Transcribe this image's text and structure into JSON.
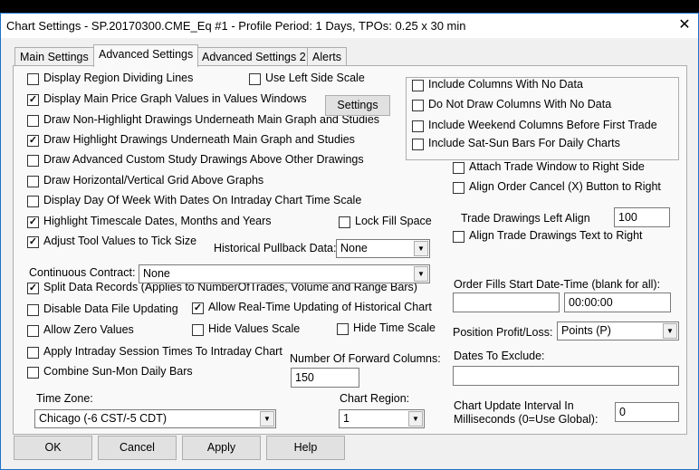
{
  "window": {
    "title": "Chart Settings - SP.20170300.CME_Eq  #1 - Profile Period: 1 Days, TPOs: 0.25 x 30 min",
    "close": "✕"
  },
  "tabs": [
    "Main Settings",
    "Advanced Settings",
    "Advanced Settings 2",
    "Alerts"
  ],
  "checkboxes": [
    {
      "label": "Display Region Dividing Lines",
      "checked": false
    },
    {
      "label": "Use Left Side Scale",
      "checked": false
    },
    {
      "label": "Display Main Price Graph Values in Values Windows",
      "checked": true
    },
    {
      "label": "Draw Non-Highlight Drawings Underneath Main Graph and Studies",
      "checked": false
    },
    {
      "label": "Draw Highlight Drawings Underneath Main Graph and Studies",
      "checked": true
    },
    {
      "label": "Draw Advanced Custom Study Drawings Above Other Drawings",
      "checked": false
    },
    {
      "label": "Draw Horizontal/Vertical Grid Above Graphs",
      "checked": false
    },
    {
      "label": "Display Day Of Week With Dates On Intraday Chart Time Scale",
      "checked": false
    },
    {
      "label": "Highlight Timescale Dates, Months and Years",
      "checked": true
    },
    {
      "label": "Lock Fill Space",
      "checked": false
    },
    {
      "label": "Adjust Tool Values to Tick Size",
      "checked": true
    },
    {
      "label": "Split Data Records (Applies to NumberOfTrades, Volume and Range Bars)",
      "checked": true
    },
    {
      "label": "Disable Data File Updating",
      "checked": false
    },
    {
      "label": "Allow Real-Time Updating of Historical Chart",
      "checked": true
    },
    {
      "label": "Allow Zero Values",
      "checked": false
    },
    {
      "label": "Hide Values Scale",
      "checked": false
    },
    {
      "label": "Hide Time Scale",
      "checked": false
    },
    {
      "label": "Apply Intraday Session Times To Intraday Chart",
      "checked": false
    },
    {
      "label": "Combine Sun-Mon Daily Bars",
      "checked": false
    },
    {
      "label": "Include Columns With No Data",
      "checked": false
    },
    {
      "label": "Do Not Draw Columns With No Data",
      "checked": false
    },
    {
      "label": "Include Weekend Columns Before First Trade",
      "checked": false
    },
    {
      "label": "Include Sat-Sun Bars For Daily Charts",
      "checked": false
    },
    {
      "label": "Attach Trade Window to Right Side",
      "checked": false
    },
    {
      "label": "Align Order Cancel (X) Button to Right",
      "checked": false
    },
    {
      "label": "Align Trade Drawings Text to Right",
      "checked": false
    }
  ],
  "labels": {
    "settings_button": "Settings",
    "historical_pullback": "Historical Pullback Data:",
    "continuous_contract": "Continuous Contract:",
    "forward_columns": "Number Of Forward Columns:",
    "time_zone": "Time Zone:",
    "chart_region": "Chart Region:",
    "trade_left_align": "Trade Drawings Left Align",
    "order_fills": "Order Fills Start Date-Time (blank for all):",
    "position_pl": "Position Profit/Loss:",
    "dates_exclude": "Dates To Exclude:",
    "update_interval_1": "Chart Update Interval In",
    "update_interval_2": "Milliseconds (0=Use Global):"
  },
  "values": {
    "historical_pullback": "None",
    "continuous_contract": "None",
    "forward_columns": "150",
    "time_zone": "Chicago (-6 CST/-5 CDT)",
    "chart_region": "1",
    "trade_left_align": "100",
    "order_fills_date": "",
    "order_fills_time": "00:00:00",
    "position_pl": "Points (P)",
    "dates_exclude": "",
    "update_interval": "0"
  },
  "buttons": {
    "ok": "OK",
    "cancel": "Cancel",
    "apply": "Apply",
    "help": "Help"
  }
}
